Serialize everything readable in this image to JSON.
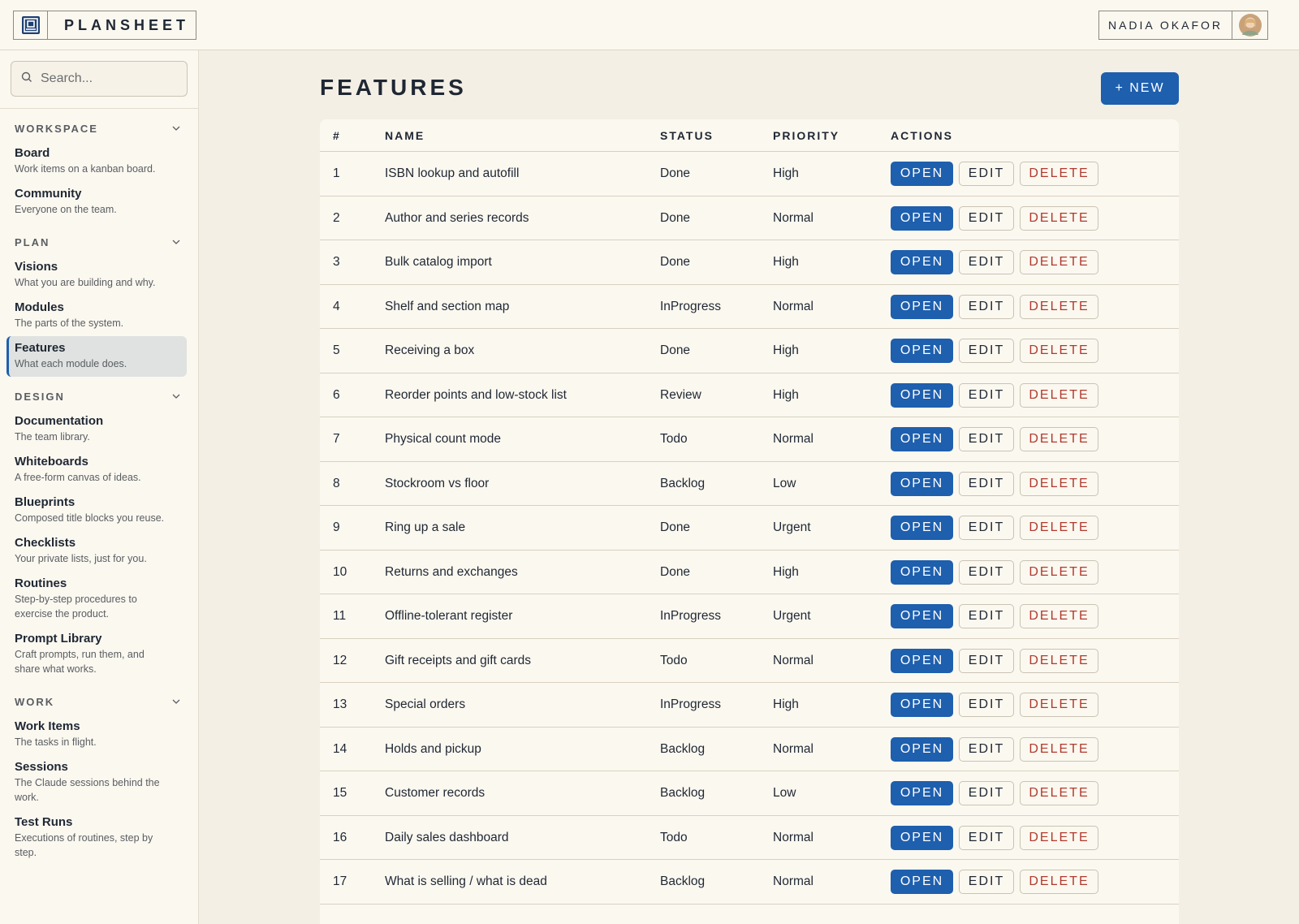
{
  "app": {
    "name": "PLANSHEET",
    "user_name": "NADIA OKAFOR"
  },
  "search": {
    "placeholder": "Search..."
  },
  "sidebar": {
    "sections": [
      {
        "title": "WORKSPACE",
        "items": [
          {
            "label": "Board",
            "desc": "Work items on a kanban board."
          },
          {
            "label": "Community",
            "desc": "Everyone on the team."
          }
        ]
      },
      {
        "title": "PLAN",
        "items": [
          {
            "label": "Visions",
            "desc": "What you are building and why."
          },
          {
            "label": "Modules",
            "desc": "The parts of the system."
          },
          {
            "label": "Features",
            "desc": "What each module does.",
            "active": true
          }
        ]
      },
      {
        "title": "DESIGN",
        "items": [
          {
            "label": "Documentation",
            "desc": "The team library."
          },
          {
            "label": "Whiteboards",
            "desc": "A free-form canvas of ideas."
          },
          {
            "label": "Blueprints",
            "desc": "Composed title blocks you reuse."
          },
          {
            "label": "Checklists",
            "desc": "Your private lists, just for you."
          },
          {
            "label": "Routines",
            "desc": "Step-by-step procedures to exercise the product."
          },
          {
            "label": "Prompt Library",
            "desc": "Craft prompts, run them, and share what works."
          }
        ]
      },
      {
        "title": "WORK",
        "items": [
          {
            "label": "Work Items",
            "desc": "The tasks in flight."
          },
          {
            "label": "Sessions",
            "desc": "The Claude sessions behind the work."
          },
          {
            "label": "Test Runs",
            "desc": "Executions of routines, step by step."
          }
        ]
      }
    ]
  },
  "main": {
    "title": "FEATURES",
    "new_label": "+ NEW",
    "columns": [
      "#",
      "NAME",
      "STATUS",
      "PRIORITY",
      "ACTIONS"
    ],
    "actions": {
      "open": "OPEN",
      "edit": "EDIT",
      "delete": "DELETE"
    },
    "rows": [
      {
        "num": "1",
        "name": "ISBN lookup and autofill",
        "status": "Done",
        "priority": "High"
      },
      {
        "num": "2",
        "name": "Author and series records",
        "status": "Done",
        "priority": "Normal"
      },
      {
        "num": "3",
        "name": "Bulk catalog import",
        "status": "Done",
        "priority": "High"
      },
      {
        "num": "4",
        "name": "Shelf and section map",
        "status": "InProgress",
        "priority": "Normal"
      },
      {
        "num": "5",
        "name": "Receiving a box",
        "status": "Done",
        "priority": "High"
      },
      {
        "num": "6",
        "name": "Reorder points and low-stock list",
        "status": "Review",
        "priority": "High"
      },
      {
        "num": "7",
        "name": "Physical count mode",
        "status": "Todo",
        "priority": "Normal"
      },
      {
        "num": "8",
        "name": "Stockroom vs floor",
        "status": "Backlog",
        "priority": "Low"
      },
      {
        "num": "9",
        "name": "Ring up a sale",
        "status": "Done",
        "priority": "Urgent"
      },
      {
        "num": "10",
        "name": "Returns and exchanges",
        "status": "Done",
        "priority": "High"
      },
      {
        "num": "11",
        "name": "Offline-tolerant register",
        "status": "InProgress",
        "priority": "Urgent"
      },
      {
        "num": "12",
        "name": "Gift receipts and gift cards",
        "status": "Todo",
        "priority": "Normal"
      },
      {
        "num": "13",
        "name": "Special orders",
        "status": "InProgress",
        "priority": "High"
      },
      {
        "num": "14",
        "name": "Holds and pickup",
        "status": "Backlog",
        "priority": "Normal"
      },
      {
        "num": "15",
        "name": "Customer records",
        "status": "Backlog",
        "priority": "Low"
      },
      {
        "num": "16",
        "name": "Daily sales dashboard",
        "status": "Todo",
        "priority": "Normal"
      },
      {
        "num": "17",
        "name": "What is selling / what is dead",
        "status": "Backlog",
        "priority": "Normal"
      }
    ]
  },
  "icons": {
    "brand": "planner-board-icon",
    "search": "search-icon",
    "chevron": "chevron-down-icon",
    "avatar": "user-avatar"
  },
  "colors": {
    "accent": "#1e5fae",
    "danger": "#b13a2e",
    "background": "#f3efe4",
    "surface": "#fbf8f0"
  }
}
